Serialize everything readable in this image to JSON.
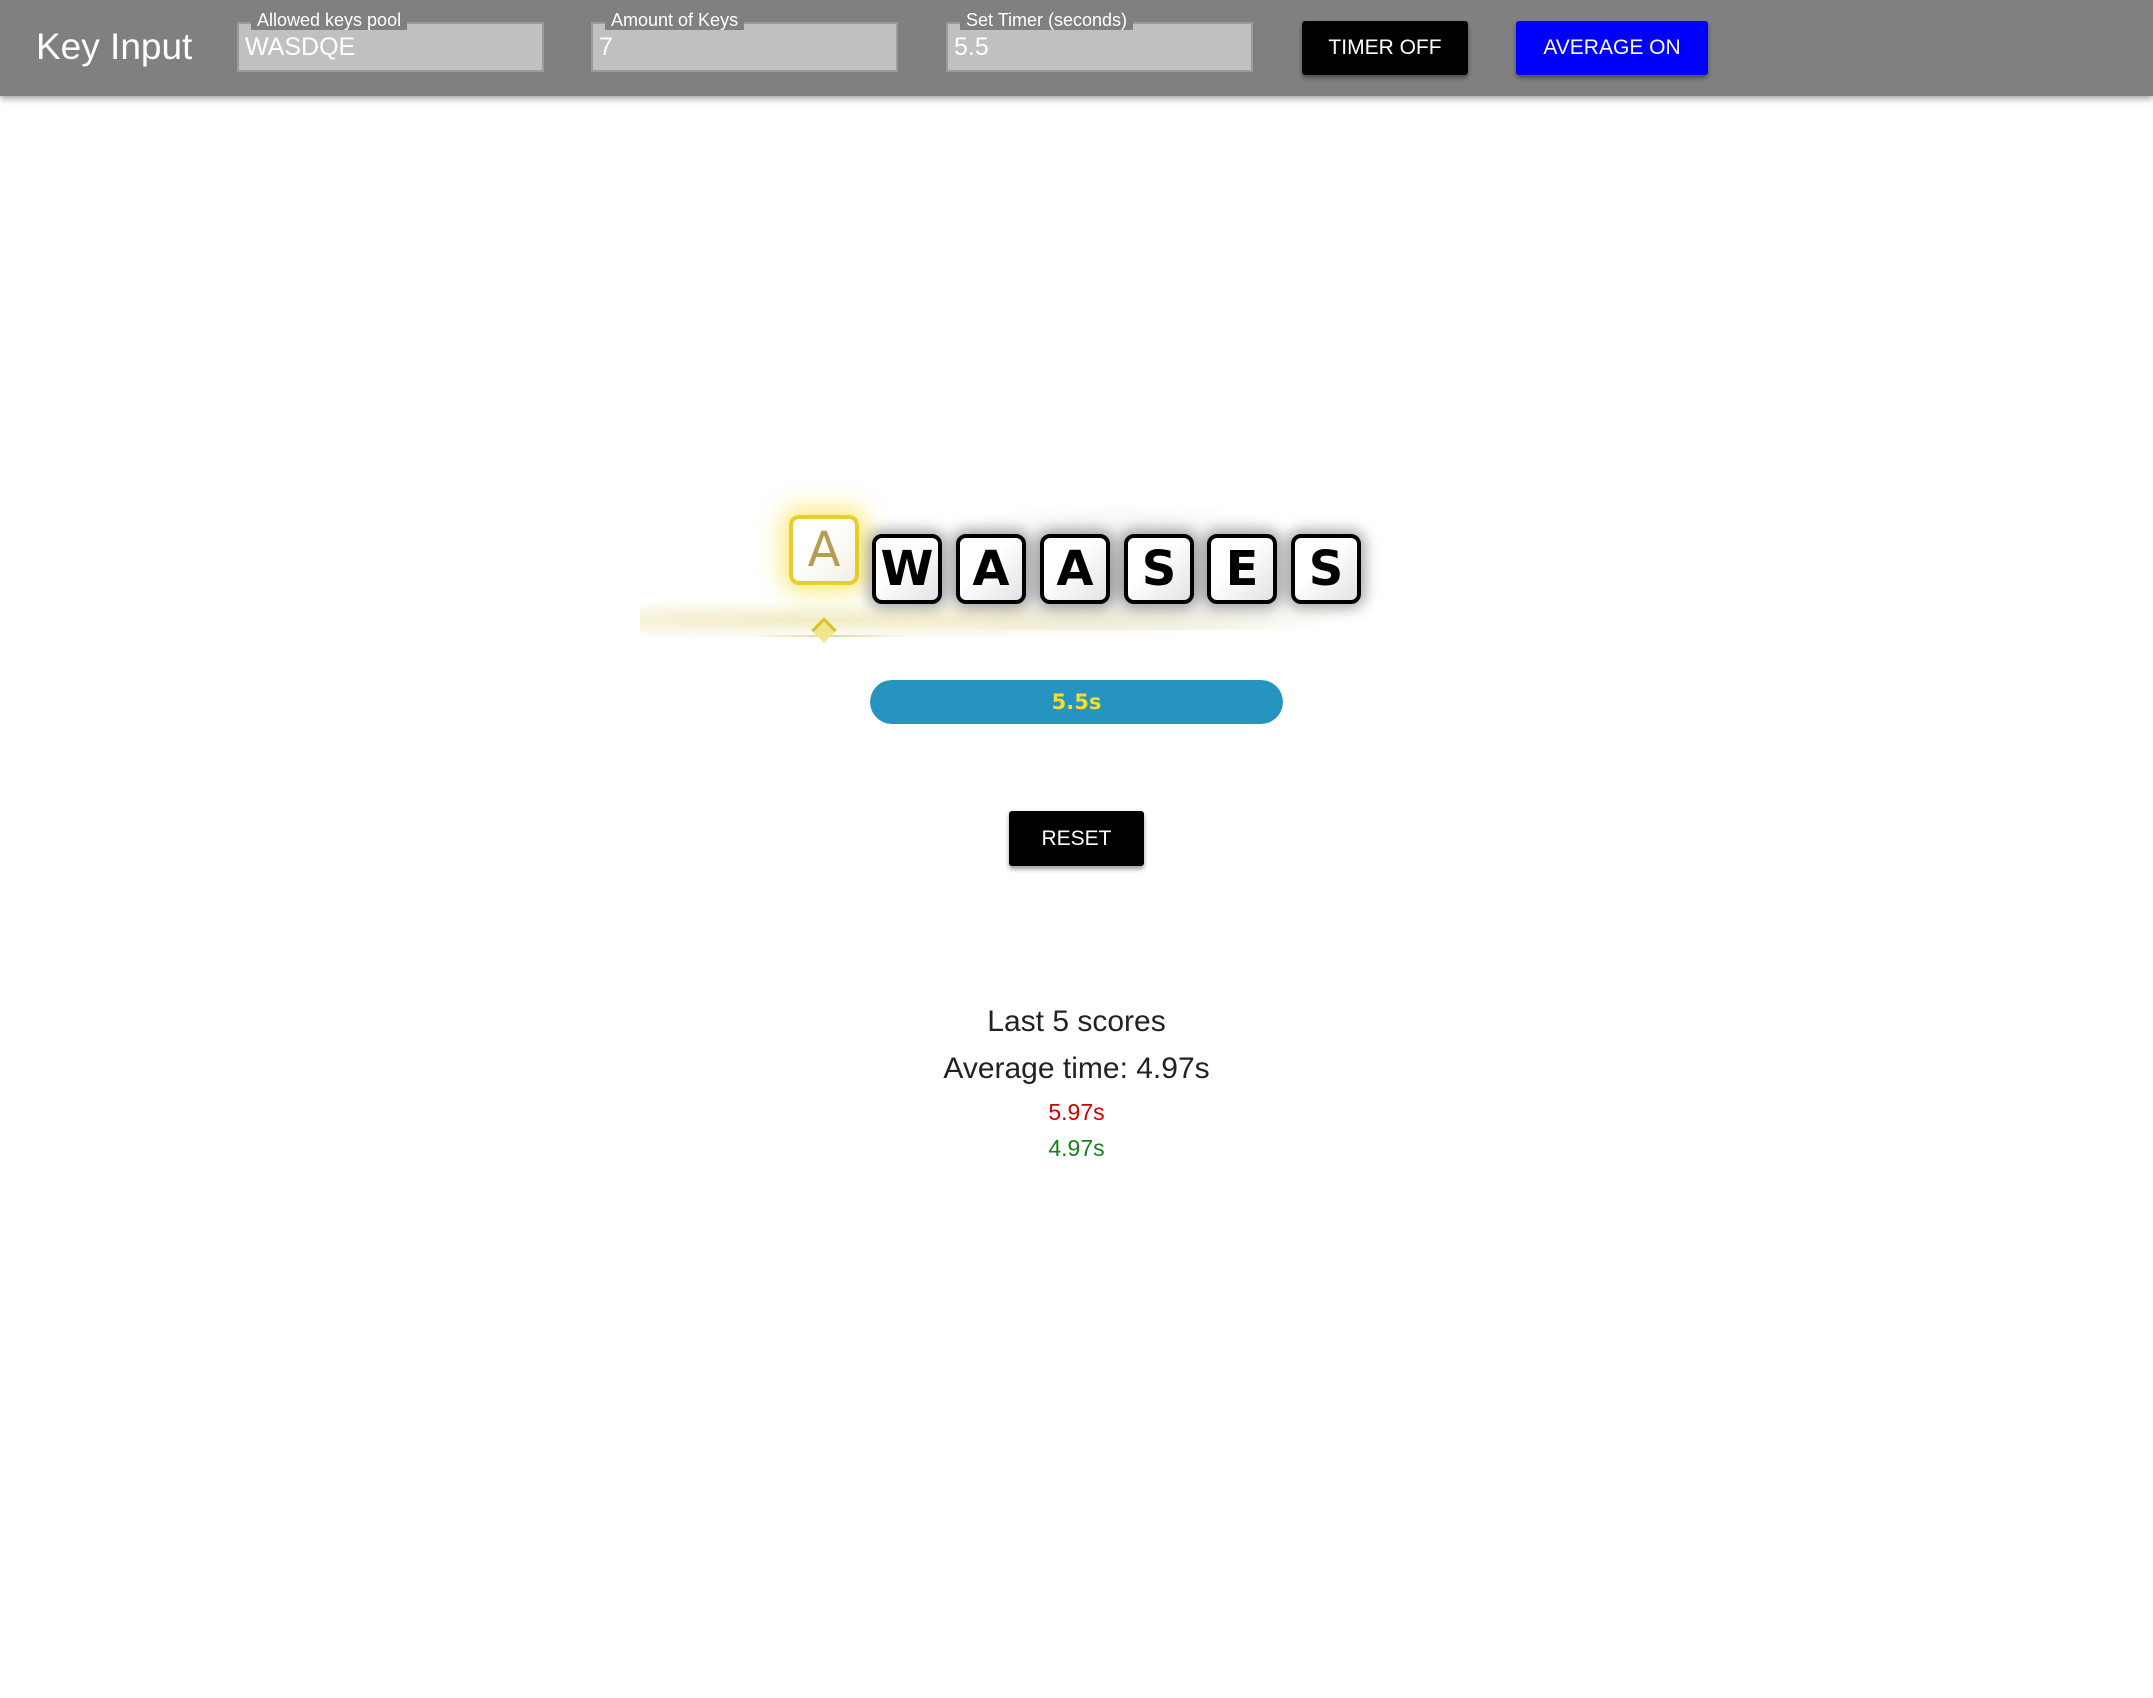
{
  "header": {
    "app_title": "Key Input",
    "fields": [
      {
        "label": "Allowed keys pool",
        "value": "WASDQE"
      },
      {
        "label": "Amount of Keys",
        "value": "7"
      },
      {
        "label": "Set Timer (seconds)",
        "value": "5.5"
      }
    ],
    "timer_button_label": "TIMER OFF",
    "average_button_label": "AVERAGE ON",
    "colors": {
      "bar": "#808080",
      "timer_button": "#000000",
      "average_button": "#0000ff"
    }
  },
  "game": {
    "active_key": "A",
    "keys": [
      "W",
      "A",
      "A",
      "S",
      "E",
      "S"
    ],
    "timer_text": "5.5s",
    "timer_fill_fraction": 1.0,
    "reset_label": "RESET",
    "colors": {
      "active_border": "#e6cf2a",
      "timer_fill": "#2694c0",
      "timer_text": "#f2de2e"
    }
  },
  "scores": {
    "heading": "Last 5 scores",
    "average": "Average time: 4.97s",
    "items": [
      {
        "value": "5.97s",
        "color": "#cc0000"
      },
      {
        "value": "4.97s",
        "color": "#1a7f1a"
      }
    ]
  }
}
